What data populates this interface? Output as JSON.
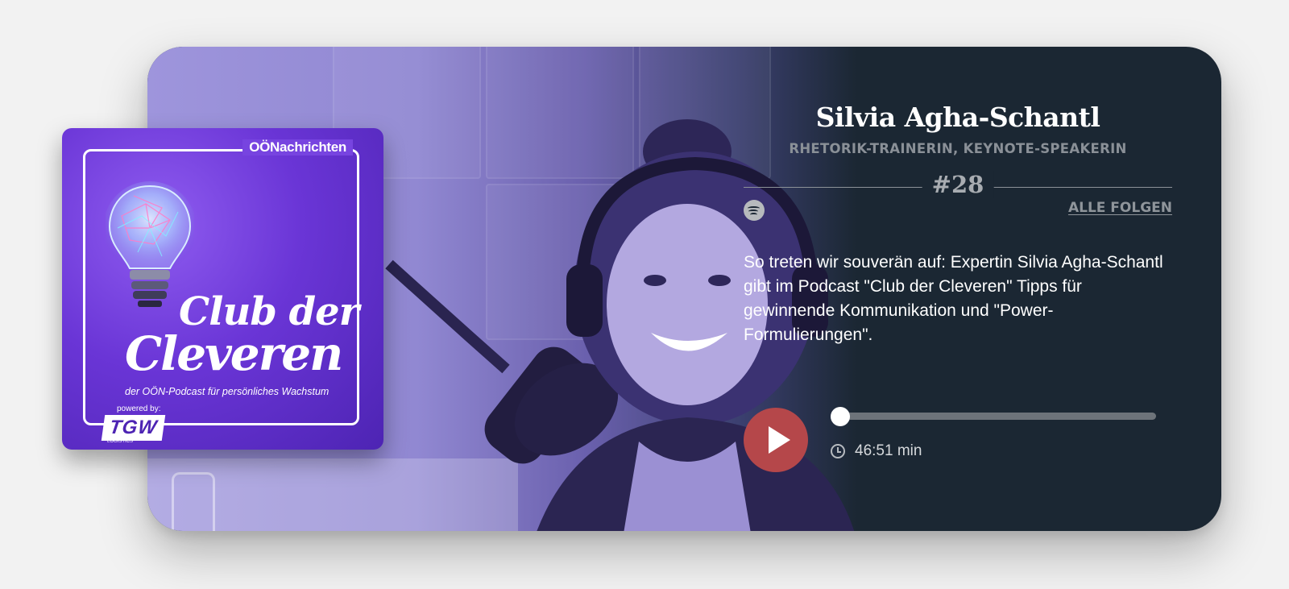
{
  "podcast": {
    "brand": "OÖNachrichten",
    "title_line1": "Club der",
    "title_line2": "Cleveren",
    "subtitle": "der OÖN-Podcast für persönliches Wachstum",
    "powered_by": "powered by:",
    "sponsor": "TGW",
    "sponsor_sub": "LOGISTICS",
    "accent_color": "#6a35d6"
  },
  "episode": {
    "guest_name": "Silvia Agha-Schantl",
    "guest_role": "RHETORIK-TRAINERIN, KEYNOTE-SPEAKERIN",
    "number": "#28",
    "all_episodes_label": "ALLE FOLGEN",
    "platform_icon": "spotify-icon",
    "description": "So treten wir souverän auf: Expertin Silvia Agha-Schantl gibt im Podcast \"Club der Cleveren\" Tipps für gewinnende Kommunikation und \"Power-Formulierungen\"."
  },
  "player": {
    "duration": "46:51 min",
    "progress": 0,
    "play_button_color": "#b5474a"
  }
}
